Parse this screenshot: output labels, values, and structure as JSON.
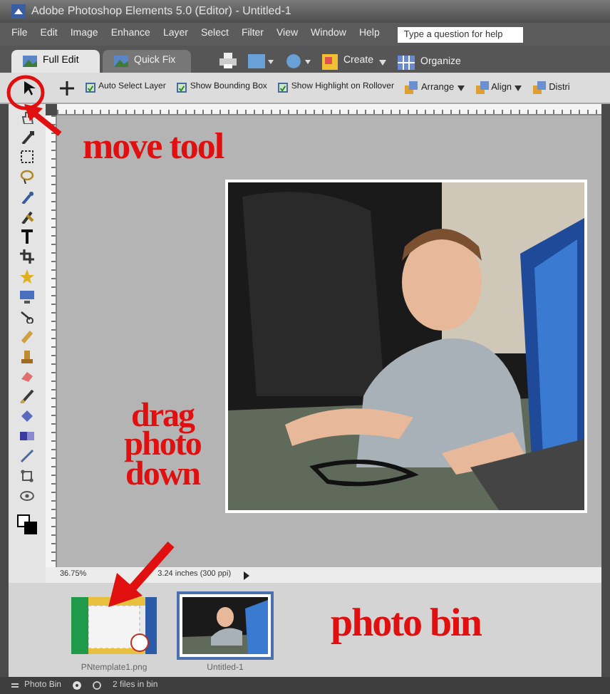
{
  "window": {
    "title": "Adobe Photoshop Elements 5.0 (Editor) - Untitled-1"
  },
  "menu": [
    "File",
    "Edit",
    "Image",
    "Enhance",
    "Layer",
    "Select",
    "Filter",
    "View",
    "Window",
    "Help"
  ],
  "help_field": {
    "placeholder": "Type a question for help"
  },
  "tabs": [
    {
      "label": "Full Edit",
      "selected": true
    },
    {
      "label": "Quick Fix",
      "selected": false
    }
  ],
  "toolbar": {
    "create": "Create",
    "organize": "Organize"
  },
  "options": {
    "checkboxes": [
      {
        "label": "Auto Select Layer",
        "checked": true
      },
      {
        "label": "Show Bounding Box",
        "checked": true
      },
      {
        "label": "Show Highlight on Rollover",
        "checked": true
      }
    ],
    "dropdowns": [
      "Arrange",
      "Align",
      "Distri"
    ]
  },
  "status": {
    "zoom": "36.75%",
    "size": "3.24 inches (300 ppi)"
  },
  "photo_bin": {
    "thumbnails": [
      {
        "name": "PNtemplate1.png",
        "kind": "template",
        "selected": false
      },
      {
        "name": "Untitled-1",
        "selected": true
      }
    ]
  },
  "footer": {
    "label": "Photo Bin",
    "count": "2 files in bin"
  },
  "annotations": {
    "move_tool": "move tool",
    "drag": "drag photo down",
    "photo_bin": "photo bin"
  }
}
